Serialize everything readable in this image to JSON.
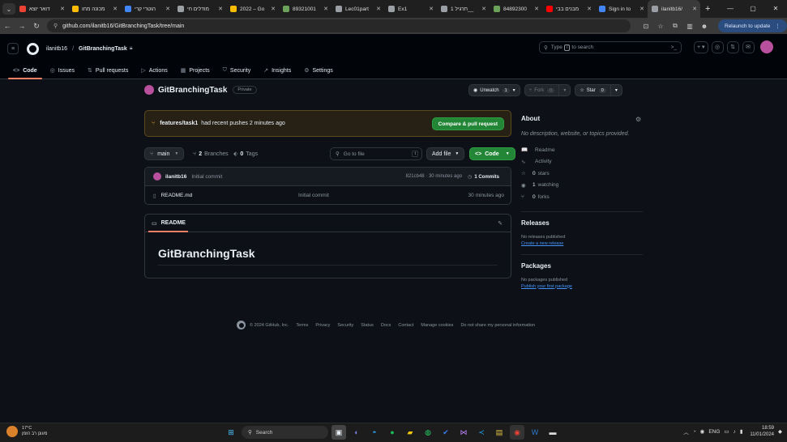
{
  "browser": {
    "tabs": [
      {
        "title": "דואר יוצא",
        "color": "#ea4335",
        "active": false
      },
      {
        "title": "מכונה מחו",
        "color": "#fbbc04",
        "active": false
      },
      {
        "title": "הוטרי קרי",
        "color": "#4285f4",
        "active": false
      },
      {
        "title": "מודלים חי",
        "color": "#9aa0a6",
        "active": false
      },
      {
        "title": "2022 – Go",
        "color": "#fbbc04",
        "active": false
      },
      {
        "title": "89321001",
        "color": "#6ba35a",
        "active": false
      },
      {
        "title": "Lec01part",
        "color": "#9aa0a6",
        "active": false
      },
      {
        "title": "Ex1",
        "color": "#9aa0a6",
        "active": false
      },
      {
        "title": "תרגיל 1__",
        "color": "#9aa0a6",
        "active": false
      },
      {
        "title": "84892300",
        "color": "#6ba35a",
        "active": false
      },
      {
        "title": "מבנים בבי",
        "color": "#ff0000",
        "active": false
      },
      {
        "title": "Sign in to",
        "color": "#4285f4",
        "active": false
      },
      {
        "title": "ilanitb16/",
        "color": "#9aa0a6",
        "active": true
      }
    ],
    "new_tab": "+",
    "url": "github.com/ilanitb16/GitBranchingTask/tree/main",
    "relaunch_label": "Relaunch to update",
    "tab_list_icon": "⌄"
  },
  "github": {
    "owner": "ilanitb16",
    "repo": "GitBranchingTask",
    "search_placeholder_pre": "Type",
    "search_key": "/",
    "search_placeholder_post": "to search",
    "nav": [
      {
        "label": "Code",
        "icon": "<>",
        "active": true
      },
      {
        "label": "Issues",
        "icon": "◎",
        "active": false
      },
      {
        "label": "Pull requests",
        "icon": "⇅",
        "active": false
      },
      {
        "label": "Actions",
        "icon": "▷",
        "active": false
      },
      {
        "label": "Projects",
        "icon": "▦",
        "active": false
      },
      {
        "label": "Security",
        "icon": "⛉",
        "active": false
      },
      {
        "label": "Insights",
        "icon": "↗",
        "active": false
      },
      {
        "label": "Settings",
        "icon": "⚙",
        "active": false
      }
    ],
    "visibility": "Private",
    "unwatch_label": "Unwatch",
    "watch_count": "1",
    "fork_label": "Fork",
    "fork_count": "0",
    "star_label": "Star",
    "star_count": "0",
    "banner": {
      "branch": "features/task1",
      "text": "had recent pushes 2 minutes ago",
      "button": "Compare & pull request"
    },
    "branch_current": "main",
    "branches_count": "2",
    "branches_label": "Branches",
    "tags_count": "0",
    "tags_label": "Tags",
    "goto_placeholder": "Go to file",
    "goto_key": "t",
    "add_file_label": "Add file",
    "code_label": "Code",
    "commit": {
      "user": "ilanitb16",
      "message": "Initial commit",
      "sha_time": "821cb48 · 30 minutes ago",
      "commits_label": "1 Commits"
    },
    "files": [
      {
        "name": "README.md",
        "message": "Initial commit",
        "time": "30 minutes ago"
      }
    ],
    "readme_tab": "README",
    "readme_heading": "GitBranchingTask",
    "about": {
      "title": "About",
      "description": "No description, website, or topics provided.",
      "items": [
        {
          "icon": "📖",
          "num": "",
          "text": "Readme"
        },
        {
          "icon": "∿",
          "num": "",
          "text": "Activity"
        },
        {
          "icon": "☆",
          "num": "0",
          "text": "stars"
        },
        {
          "icon": "◉",
          "num": "1",
          "text": "watching"
        },
        {
          "icon": "⑂",
          "num": "0",
          "text": "forks"
        }
      ]
    },
    "releases": {
      "title": "Releases",
      "none": "No releases published",
      "link": "Create a new release"
    },
    "packages": {
      "title": "Packages",
      "none": "No packages published",
      "link": "Publish your first package"
    },
    "footer": [
      "© 2024 GitHub, Inc.",
      "Terms",
      "Privacy",
      "Security",
      "Status",
      "Docs",
      "Contact",
      "Manage cookies",
      "Do not share my personal information"
    ]
  },
  "taskbar": {
    "weather_temp": "17°C",
    "weather_desc": "מעונן רב הזמן",
    "search_label": "Search",
    "lang": "ENG",
    "time": "18:59",
    "date": "11/01/2024"
  }
}
